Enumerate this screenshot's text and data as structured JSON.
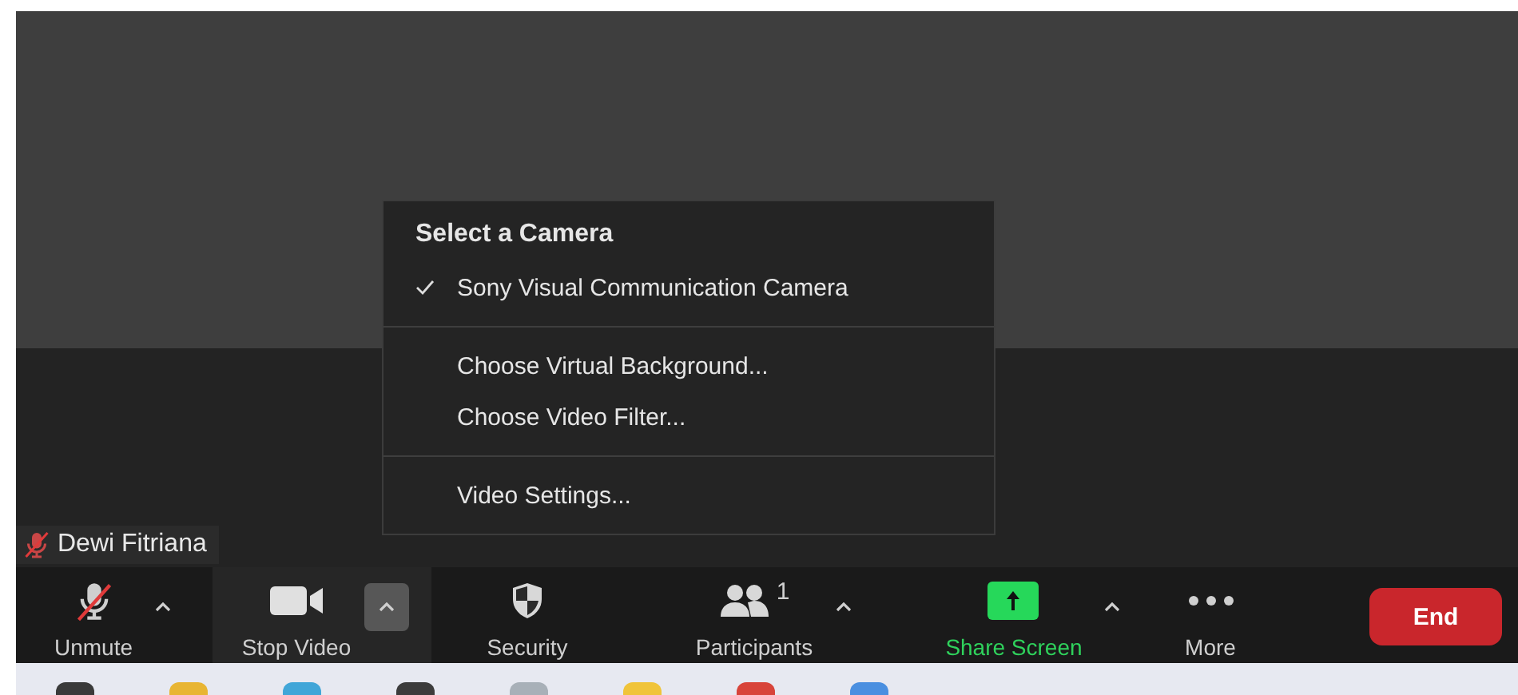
{
  "participant": {
    "name": "Dewi Fitriana",
    "muted": true
  },
  "camera_menu": {
    "title": "Select a Camera",
    "cameras": [
      {
        "label": "Sony Visual Communication Camera",
        "selected": true
      }
    ],
    "sections": [
      [
        "Choose Virtual Background...",
        "Choose Video Filter..."
      ],
      [
        "Video Settings..."
      ]
    ]
  },
  "toolbar": [
    {
      "kind": "mute",
      "label": "Unmute",
      "has_menu": true,
      "menu_open": false
    },
    {
      "kind": "video",
      "label": "Stop Video",
      "has_menu": true,
      "menu_open": true
    },
    {
      "kind": "security",
      "label": "Security",
      "has_menu": false
    },
    {
      "kind": "participants",
      "label": "Participants",
      "count": "1",
      "has_menu": true,
      "menu_open": false
    },
    {
      "kind": "share",
      "label": "Share Screen",
      "has_menu": true,
      "menu_open": false
    },
    {
      "kind": "more",
      "label": "More",
      "has_menu": false
    }
  ],
  "end_button": "End"
}
